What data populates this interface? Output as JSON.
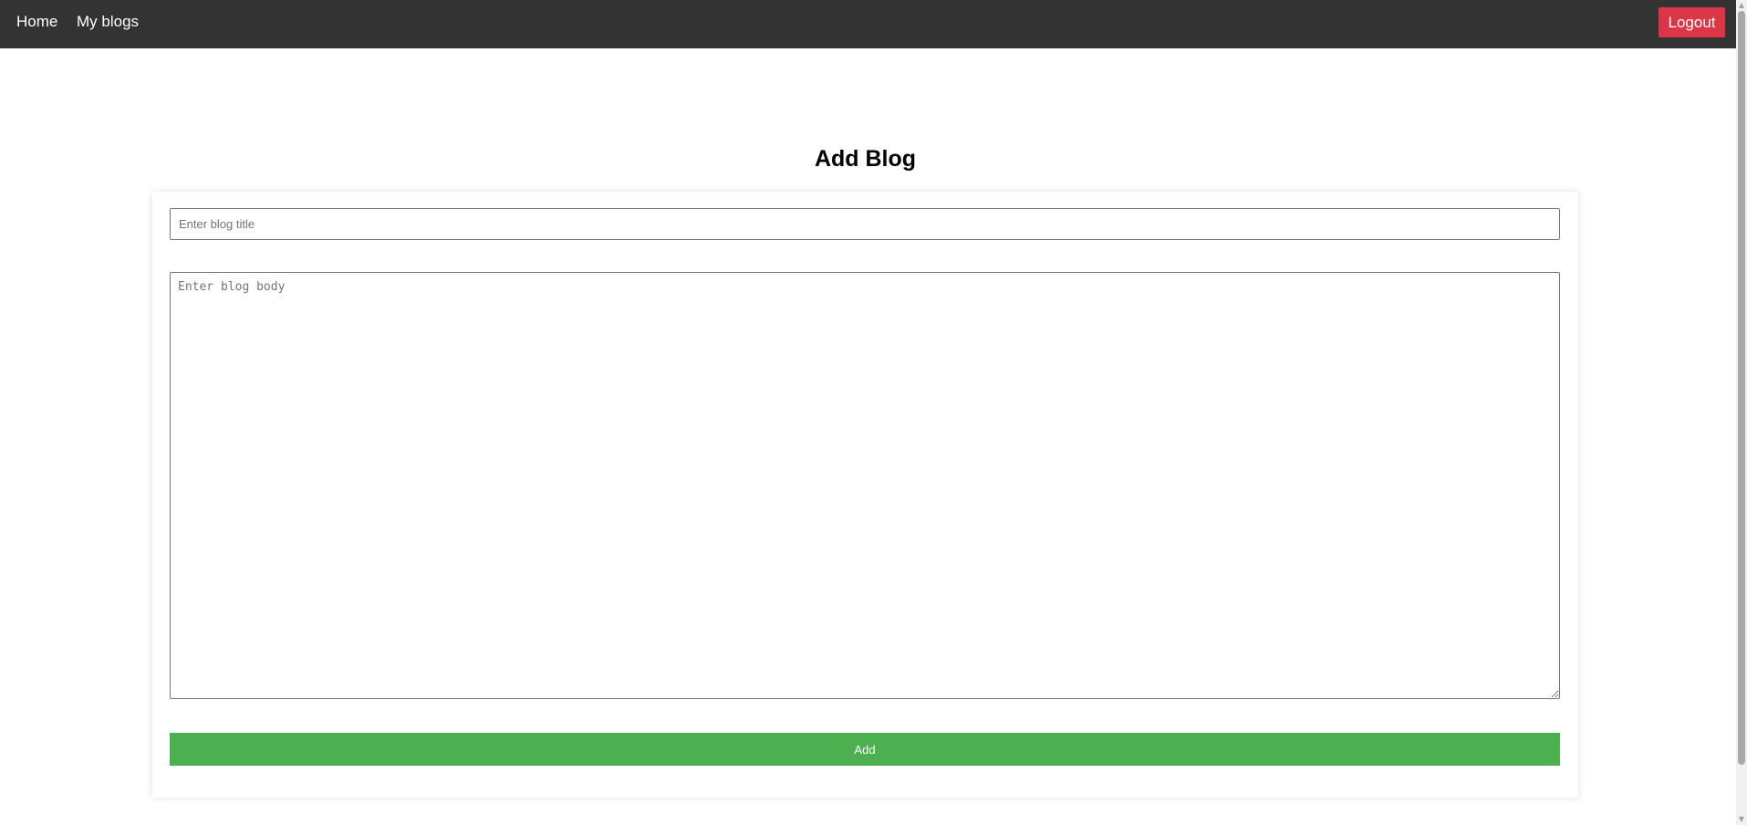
{
  "navbar": {
    "links": [
      {
        "label": "Home"
      },
      {
        "label": "My blogs"
      }
    ],
    "logout_label": "Logout",
    "background": "#333333",
    "logout_color": "#dc3545"
  },
  "page": {
    "title": "Add Blog"
  },
  "form": {
    "title_value": "",
    "title_placeholder": "Enter blog title",
    "body_value": "",
    "body_placeholder": "Enter blog body",
    "submit_label": "Add",
    "submit_color": "#4caf50"
  },
  "scrollbar": {
    "up_icon": "triangle-up-icon",
    "down_icon": "triangle-down-icon"
  }
}
